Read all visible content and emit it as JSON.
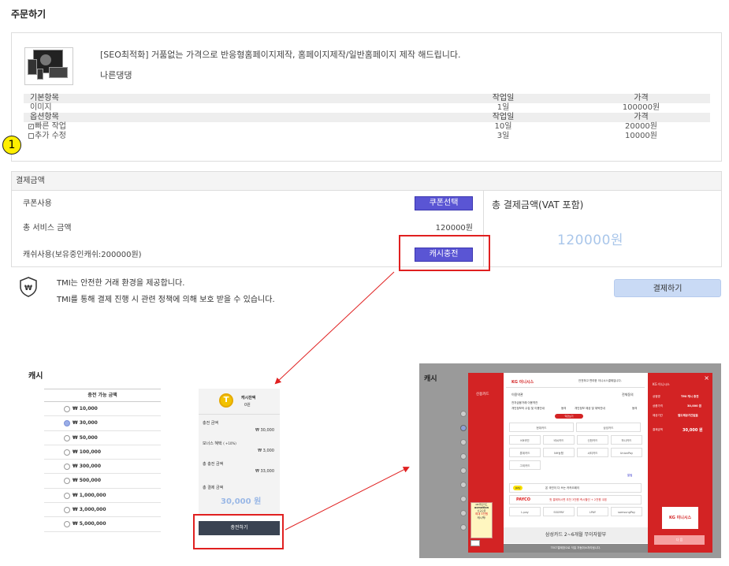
{
  "page_title": "주문하기",
  "product": {
    "title": "[SEO최적화] 거품없는 가격으로 반응형홈페이지제작, 홈페이지제작/일반홈페이지 제작 해드립니다.",
    "seller": "나른댕댕"
  },
  "basic_items": {
    "headers": [
      "기본항목",
      "작업일",
      "가격"
    ],
    "rows": [
      [
        "이미지",
        "1일",
        "100000원"
      ]
    ]
  },
  "option_items": {
    "headers": [
      "옵션항목",
      "작업일",
      "가격"
    ],
    "rows": [
      {
        "label": "빠른 작업",
        "checked": true,
        "days": "10일",
        "price": "20000원"
      },
      {
        "label": "추가 수정",
        "checked": false,
        "days": "3일",
        "price": "10000원"
      }
    ]
  },
  "annotation_number": "1",
  "payment": {
    "header": "결제금액",
    "coupon_label": "쿠폰사용",
    "coupon_button": "쿠폰선택",
    "service_label": "총 서비스 금액",
    "service_amount": "120000원",
    "cash_label": "캐쉬사용(보유중인캐쉬:200000원)",
    "cash_button": "캐시충전",
    "total_label": "총 결제금액(VAT 포함)",
    "total_amount": "120000원"
  },
  "info": {
    "line1": "TMI는 안전한 거래 환경을 제공합니다.",
    "line2": "TMI를 통해 결제 진행 시 관련 정책에 의해 보호 받을 수 있습니다.",
    "pay_button": "결제하기"
  },
  "cash_charge": {
    "title": "캐시",
    "list_header": "충전 가능 금액",
    "amounts": [
      "₩ 10,000",
      "₩ 30,000",
      "₩ 50,000",
      "₩ 100,000",
      "₩ 300,000",
      "₩ 500,000",
      "₩ 1,000,000",
      "₩ 3,000,000",
      "₩ 5,000,000"
    ],
    "selected_index": 1,
    "balance_label": "캐시잔액",
    "balance": "0원",
    "charge_amount_label": "충전 금액",
    "charge_amount": "₩ 30,000",
    "bonus_label": "보너스 혜택",
    "bonus_rate": "( +10%)",
    "bonus": "₩ 3,000",
    "total_charge_label": "총 충전 금액",
    "total_charge": "₩ 33,000",
    "total_pay_label": "총 결제 금액",
    "total_pay": "30,000 원",
    "charge_button": "충전하기"
  },
  "kg_popup": {
    "title": "캐시",
    "left_label": "신용카드",
    "brand": "KG 이니시스",
    "tagline": "안전하고 편리한 이니시스결제입니다.",
    "agree_all": "전체동의",
    "terms": "이용약관",
    "terms_line1": "전자금융거래 이용약관",
    "terms_line2": "개인정보의 수집 및 이용안내",
    "agree": "동의",
    "terms_line3": "개인정보 제공 및 위탁안내",
    "more": "약관보기",
    "card_top": [
      "현대카드",
      "삼성카드"
    ],
    "cards": [
      "KB국민",
      "비씨카드",
      "신한카드",
      "하나카드",
      "롯데카드",
      "NH농협",
      "씨티카드",
      "UnionPay",
      "그외카드"
    ],
    "pay_label": "pay",
    "pay_text": "온 국민이 다 쓰는 카카오페이",
    "payco": "PAYCO",
    "payco_text": "첫 결제하시면 추천 3천원 즉시할인 + 2천원 쿠폰",
    "wallets": [
      "L.pay",
      "SSGPAY",
      "LPAY",
      "samsungPay"
    ],
    "banner": "삼성카드 2~6개월 무이자할부",
    "footer": "TEST결제창으로 익일 자동취소처리됩니다.",
    "side_ad": [
      "KB국민카드",
      "acmotion",
      "신규오픈",
      "최대 5천원",
      "캐시백!"
    ],
    "link": "알림",
    "right_brand": "KG 이니시스",
    "right_rows": [
      [
        "상점명",
        "TMI 캐시 충전"
      ],
      [
        "상품가격",
        "30,000 원"
      ],
      [
        "제공기간",
        "별도제공기간없음"
      ],
      [
        "결제금액",
        "30,000 원"
      ]
    ],
    "right_logo": "KG 이니시스",
    "right_button": "다 음"
  }
}
